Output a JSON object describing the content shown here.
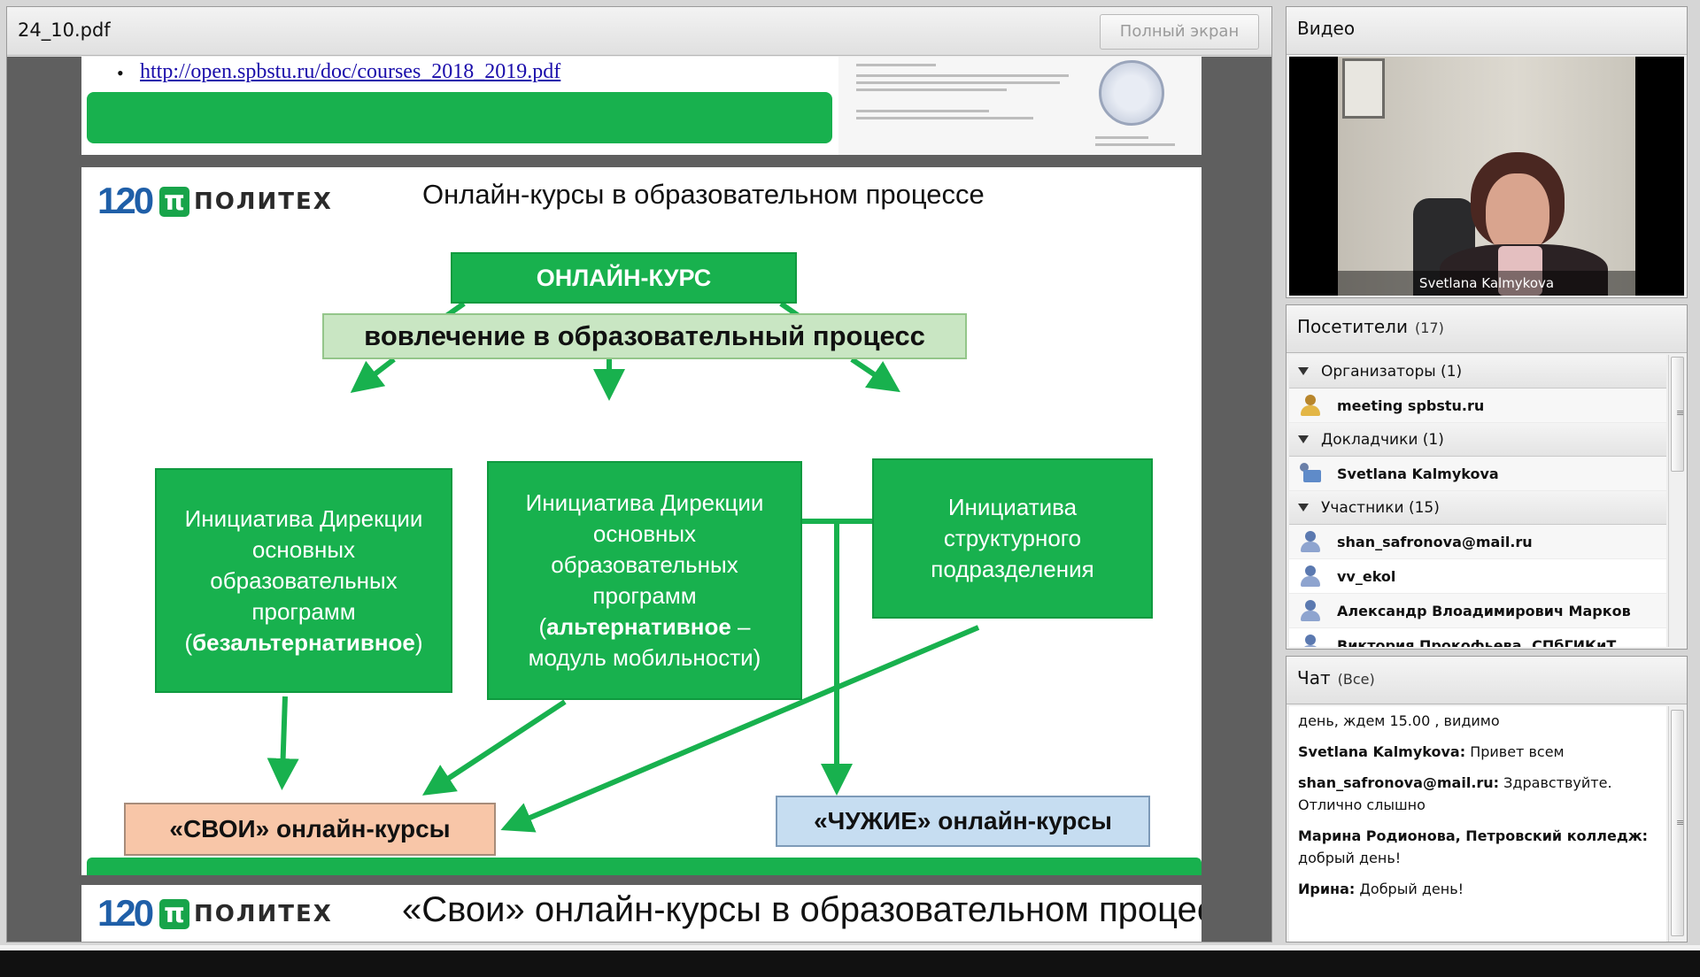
{
  "document": {
    "title": "24_10.pdf",
    "fullscreen_label": "Полный экран"
  },
  "prev_page": {
    "bullet": "•",
    "link": "http://open.spbstu.ru/doc/courses_2018_2019.pdf"
  },
  "slide": {
    "logo_number": "120",
    "logo_pi": "π",
    "logo_text": "ПОЛИТЕХ",
    "title": "Онлайн-курсы в образовательном процессе",
    "online_course": "ОНЛАЙН-КУРС",
    "engagement": "вовлечение в образовательный процесс",
    "init1_text": "Инициатива Дирекции основных образовательных программ",
    "init1_open": "(",
    "init1_bold": "безальтернативное",
    "init1_close": ")",
    "init2_text": "Инициатива Дирекции основных образовательных программ",
    "init2_open": "(",
    "init2_bold": "альтернативное",
    "init2_rest": " – модуль мобильности)",
    "init3_text": "Инициатива структурного подразделения",
    "svoi": "«СВОИ» онлайн-курсы",
    "chuzhie": "«ЧУЖИЕ» онлайн-курсы"
  },
  "next_slide": {
    "logo_number": "120",
    "logo_pi": "π",
    "logo_text": "ПОЛИТЕХ",
    "title": "«Свои» онлайн-курсы в образовательном процессе"
  },
  "video": {
    "title": "Видео",
    "speaker": "Svetlana Kalmykova"
  },
  "attendees": {
    "title": "Посетители",
    "count": "(17)",
    "groups": [
      {
        "label": "Организаторы (1)",
        "users": [
          {
            "name": "meeting spbstu.ru",
            "icon": "host-icon"
          }
        ]
      },
      {
        "label": "Докладчики (1)",
        "users": [
          {
            "name": "Svetlana Kalmykova",
            "icon": "presenter-icon"
          }
        ]
      },
      {
        "label": "Участники (15)",
        "users": [
          {
            "name": "shan_safronova@mail.ru",
            "icon": "user-icon"
          },
          {
            "name": "vv_ekol",
            "icon": "user-icon"
          },
          {
            "name": "Александр Влоадимирович Марков",
            "icon": "user-icon"
          },
          {
            "name": "Виктория Прокофьева, СПбГИКиТ",
            "icon": "user-icon"
          }
        ]
      }
    ]
  },
  "chat": {
    "title": "Чат",
    "scope": "(Все)",
    "messages": [
      {
        "sender": "",
        "text": "день, ждем 15.00 , видимо"
      },
      {
        "sender": "Svetlana Kalmykova:",
        "text": " Привет всем"
      },
      {
        "sender": "shan_safronova@mail.ru:",
        "text": " Здравствуйте. Отлично слышно"
      },
      {
        "sender": "Марина Родионова, Петровский колледж:",
        "text": " добрый день!"
      },
      {
        "sender": "Ирина:",
        "text": " Добрый день!"
      }
    ]
  },
  "colors": {
    "slide_green": "#18b14e",
    "engage_fill": "#c9e6c3",
    "svoi_fill": "#f8c6a8",
    "chuzhie_fill": "#c6ddf1",
    "logo_blue": "#1f5fa8"
  }
}
